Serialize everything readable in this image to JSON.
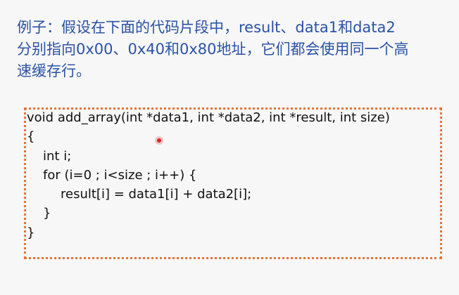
{
  "description": {
    "lines": [
      "例子：假设在下面的代码片段中，result、data1和data2",
      "分别指向0x00、0x40和0x80地址，它们都会使用同一个高",
      "速缓存行。"
    ]
  },
  "code": {
    "lines": [
      "void add_array(int *data1, int *data2, int *result, int size)",
      "{",
      "int i;",
      "for (i=0 ; i<size ; i++) {",
      "result[i] = data1[i] + data2[i];",
      "}",
      "}"
    ]
  },
  "colors": {
    "description_text": "#2a52a6",
    "box_border": "#e3743a",
    "pointer": "#e3222a"
  }
}
